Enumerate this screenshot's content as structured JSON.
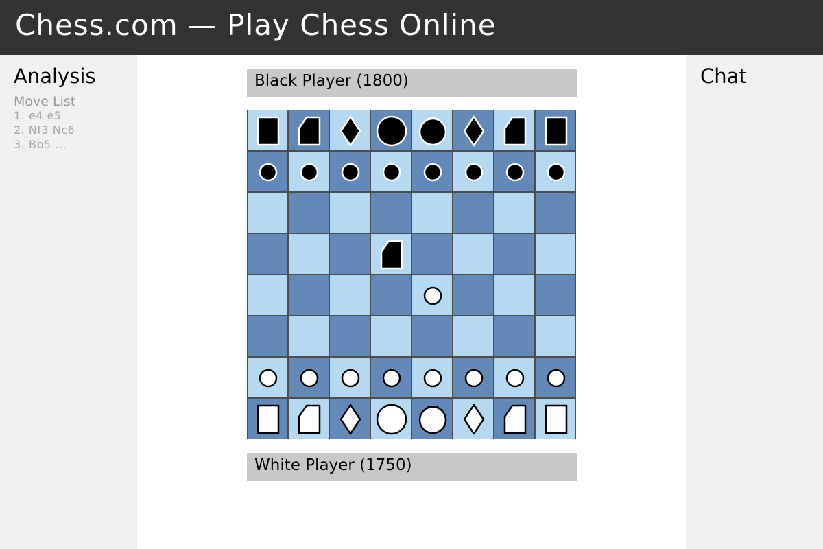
{
  "header": {
    "title": "Chess.com — Play Chess Online"
  },
  "left_panel": {
    "title": "Analysis",
    "move_list_title": "Move List",
    "moves": [
      "1. e4 e5",
      "2. Nf3 Nc6",
      "3. Bb5 ..."
    ]
  },
  "right_panel": {
    "title": "Chat"
  },
  "players": {
    "black": "Black Player (1800)",
    "white": "White Player (1750)"
  },
  "board": {
    "colors": {
      "light": "#b5d9f1",
      "dark": "#6389b9"
    },
    "rows": [
      [
        "r",
        "n",
        "b",
        "q",
        "k",
        "b",
        "n",
        "r"
      ],
      [
        "p",
        "p",
        "p",
        "p",
        "p",
        "p",
        "p",
        "p"
      ],
      [
        "",
        "",
        "",
        "",
        "",
        "",
        "",
        ""
      ],
      [
        "",
        "",
        "",
        "n",
        "",
        "",
        "",
        ""
      ],
      [
        "",
        "",
        "",
        "",
        "P",
        "",
        "",
        ""
      ],
      [
        "",
        "",
        "",
        "",
        "",
        "",
        "",
        ""
      ],
      [
        "P",
        "P",
        "P",
        "P",
        "P",
        "P",
        "P",
        "P"
      ],
      [
        "R",
        "N",
        "B",
        "Q",
        "K",
        "B",
        "N",
        "R"
      ]
    ]
  }
}
